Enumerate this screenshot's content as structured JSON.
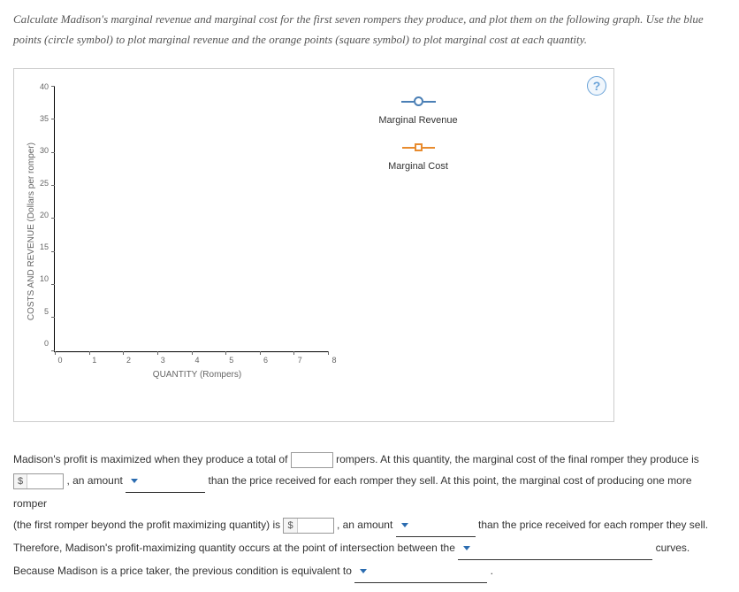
{
  "instructions": "Calculate Madison's marginal revenue and marginal cost for the first seven rompers they produce, and plot them on the following graph. Use the blue points (circle symbol) to plot marginal revenue and the orange points (square symbol) to plot marginal cost at each quantity.",
  "help_icon": "?",
  "chart_data": {
    "type": "scatter",
    "title": "",
    "xlabel": "QUANTITY (Rompers)",
    "ylabel": "COSTS AND REVENUE (Dollars per romper)",
    "x_ticks": [
      "0",
      "1",
      "2",
      "3",
      "4",
      "5",
      "6",
      "7",
      "8"
    ],
    "y_ticks": [
      "0",
      "5",
      "10",
      "15",
      "20",
      "25",
      "30",
      "35",
      "40"
    ],
    "xlim": [
      0,
      8
    ],
    "ylim": [
      0,
      40
    ],
    "series": [
      {
        "name": "Marginal Revenue",
        "symbol": "circle",
        "color": "#4a7fb5",
        "values": []
      },
      {
        "name": "Marginal Cost",
        "symbol": "square",
        "color": "#e88b2e",
        "values": []
      }
    ]
  },
  "legend": {
    "mr": "Marginal Revenue",
    "mc": "Marginal Cost"
  },
  "colors": {
    "mr": "#4a7fb5",
    "mc": "#e88b2e"
  },
  "question": {
    "p1a": "Madison's profit is maximized when they produce a total of ",
    "p1b": " rompers. At this quantity, the marginal cost of the final romper they produce is ",
    "p2a": ", an amount ",
    "p2b": " than the price received for each romper they sell. At this point, the marginal cost of producing one more romper ",
    "p3a": "(the first romper beyond the profit maximizing quantity) is ",
    "p3b": ", an amount ",
    "p3c": " than the price received for each romper they sell. ",
    "p4a": "Therefore, Madison's profit-maximizing quantity occurs at the point of intersection between the ",
    "p4b": " curves. ",
    "p5a": "Because Madison is a price taker, the previous condition is equivalent to ",
    "p5b": " .",
    "dollar_sym": "$",
    "input_qty": "",
    "input_mc1": "",
    "input_mc2": "",
    "dd1": "",
    "dd2": "",
    "dd3": "",
    "dd4": ""
  }
}
